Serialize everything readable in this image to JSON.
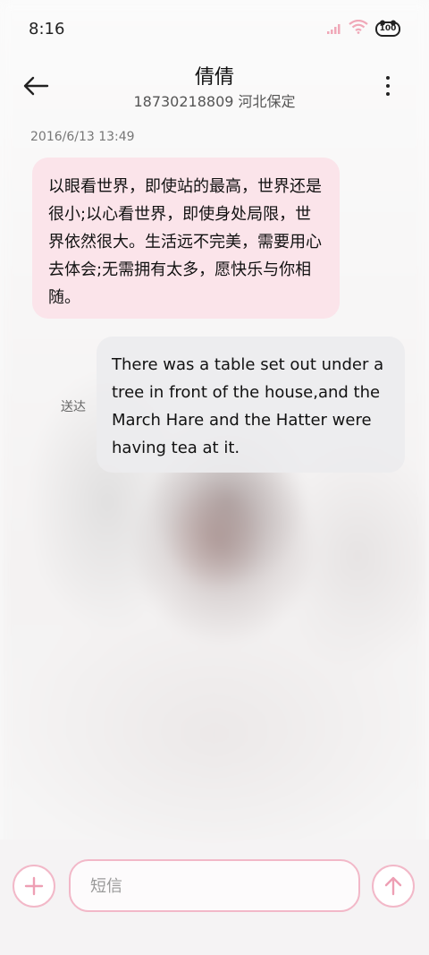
{
  "status_bar": {
    "time": "8:16",
    "battery": "100",
    "icons": [
      "signal-icon",
      "wifi-icon",
      "battery-icon"
    ]
  },
  "header": {
    "contact_name": "倩倩",
    "contact_info": "18730218809 河北保定",
    "back_icon": "back-arrow-icon",
    "more_icon": "more-vertical-icon"
  },
  "conversation": {
    "timestamp": "2016/6/13 13:49",
    "messages": [
      {
        "direction": "incoming",
        "text": "以眼看世界，即使站的最高，世界还是很小;以心看世界，即使身处局限，世界依然很大。生活远不完美，需要用心去体会;无需拥有太多，愿快乐与你相随。"
      },
      {
        "direction": "outgoing",
        "status": "送达",
        "text": "There was a table set out under a tree in front of the house,and the March Hare and the Hatter were having tea at it."
      }
    ]
  },
  "composer": {
    "placeholder": "短信",
    "add_icon": "plus-icon",
    "send_icon": "send-arrow-up-icon"
  },
  "colors": {
    "incoming_bubble": "#fbe2e8",
    "outgoing_bubble": "#ececee",
    "accent": "#f2b8c8"
  }
}
